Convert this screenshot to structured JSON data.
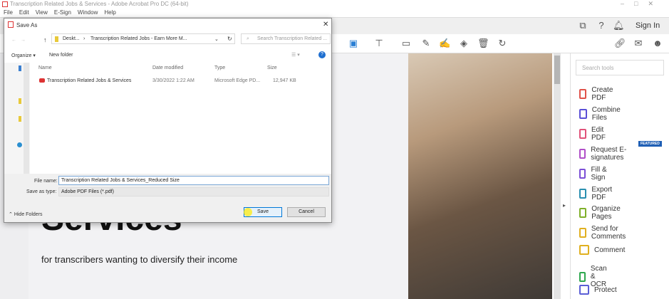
{
  "window": {
    "title": "Transcription Related Jobs & Services - Adobe Acrobat Pro DC (64-bit)"
  },
  "menu": [
    "File",
    "Edit",
    "View",
    "E-Sign",
    "Window",
    "Help"
  ],
  "topbar": {
    "sign_in": "Sign In"
  },
  "document": {
    "heading": "Services",
    "subtitle": "for transcribers wanting to diversify their income"
  },
  "tools_panel": {
    "search_placeholder": "Search tools",
    "featured_badge": "FEATURED",
    "items": [
      {
        "label": "Create PDF",
        "color": "#e0524a"
      },
      {
        "label": "Combine Files",
        "color": "#5b4fd6"
      },
      {
        "label": "Edit PDF",
        "color": "#e0527a"
      },
      {
        "label": "Request E-signatures",
        "color": "#b04fc8"
      },
      {
        "label": "Fill & Sign",
        "color": "#7b4fd6"
      },
      {
        "label": "Export PDF",
        "color": "#2a8fb0"
      },
      {
        "label": "Organize Pages",
        "color": "#7fb02a"
      },
      {
        "label": "Send for Comments",
        "color": "#e0b020"
      },
      {
        "label": "Comment",
        "color": "#e0b020"
      },
      {
        "label": "Scan & OCR",
        "color": "#2fa84f"
      },
      {
        "label": "Protect",
        "color": "#5b5fd6"
      }
    ]
  },
  "dialog": {
    "title": "Save As",
    "breadcrumb": [
      "Deskt...",
      "Transcription Related Jobs - Earn More M..."
    ],
    "search_placeholder": "Search Transcription Related ...",
    "organize": "Organize ▾",
    "new_folder": "New folder",
    "columns": [
      "Name",
      "Date modified",
      "Type",
      "Size"
    ],
    "files": [
      {
        "name": "Transcription Related Jobs & Services",
        "date": "3/30/2022 1:22 AM",
        "type": "Microsoft Edge PD...",
        "size": "12,947 KB"
      }
    ],
    "file_name_label": "File name:",
    "file_name_value": "Transcription Related Jobs & Services_Reduced Size",
    "save_type_label": "Save as type:",
    "save_type_value": "Adobe PDF Files (*.pdf)",
    "hide_folders": "Hide Folders",
    "save": "Save",
    "cancel": "Cancel"
  }
}
